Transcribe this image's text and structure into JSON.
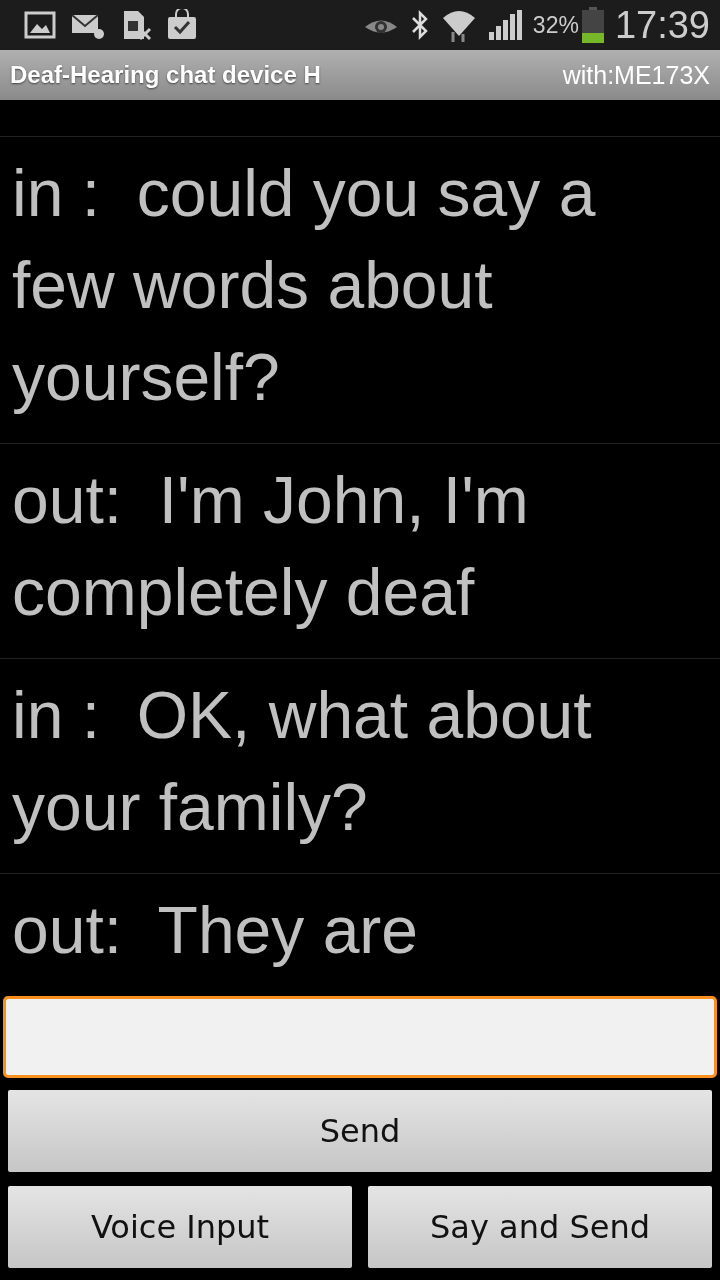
{
  "status_bar": {
    "battery_text": "32%",
    "time": "17:39"
  },
  "title_bar": {
    "title": "Deaf-Hearing chat device H",
    "subtitle": "with:ME173X"
  },
  "messages": [
    {
      "text": "in :  could you say a few words about yourself?"
    },
    {
      "text": "out:  I'm John, I'm completely deaf"
    },
    {
      "text": "in :  OK, what about your family?"
    },
    {
      "text": "out:  They are"
    }
  ],
  "message_field": {
    "focused": true
  },
  "buttons": [
    {
      "label": "Send",
      "kind": "wide"
    },
    {
      "label": "Voice Input",
      "kind": "half"
    },
    {
      "label": "Say and Send",
      "kind": "half"
    }
  ]
}
